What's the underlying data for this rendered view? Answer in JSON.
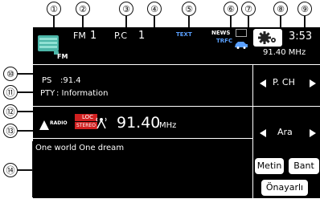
{
  "callouts": [
    "①",
    "②",
    "③",
    "④",
    "⑤",
    "⑥",
    "⑦",
    "⑧",
    "⑨",
    "⑩",
    "⑪",
    "⑫",
    "⑬",
    "⑭"
  ],
  "header": {
    "band_icon_label": "FM",
    "band_name": "FM",
    "band_number": "1",
    "preset_label": "P.C",
    "preset_number": "1",
    "text_indicator": "TEXT",
    "news_indicator": "NEWS",
    "trfc_indicator": "TRFC",
    "clock": "3:53",
    "frequency_top": "91.40 MHz"
  },
  "info": {
    "ps_label": "PS",
    "ps_value": ":91.4",
    "pty_label": "PTY",
    "pty_value": ": Information",
    "radio_text": "One world One dream"
  },
  "tuning": {
    "radio_label": "RADIO",
    "local_label": "LOC",
    "stereo_label": "STEREO",
    "frequency_main": "91.40",
    "frequency_unit": "MHz"
  },
  "controls": {
    "preset_channel_label": "P. CH",
    "area_label": "Ara",
    "text_button": "Metin",
    "band_button": "Bant",
    "presets_button": "Önayarlı"
  },
  "colors": {
    "screen_bg": "#000000",
    "indicator_blue": "#5aa0ff",
    "loc_red": "#d02020",
    "icon_teal": "#4cb6a8"
  },
  "icons": [
    "radio-band-icon",
    "settings-gear-icon",
    "signal-antenna-icon",
    "car-traffic-icon",
    "radio-logo-icon",
    "triangle-left-icon",
    "triangle-right-icon"
  ]
}
